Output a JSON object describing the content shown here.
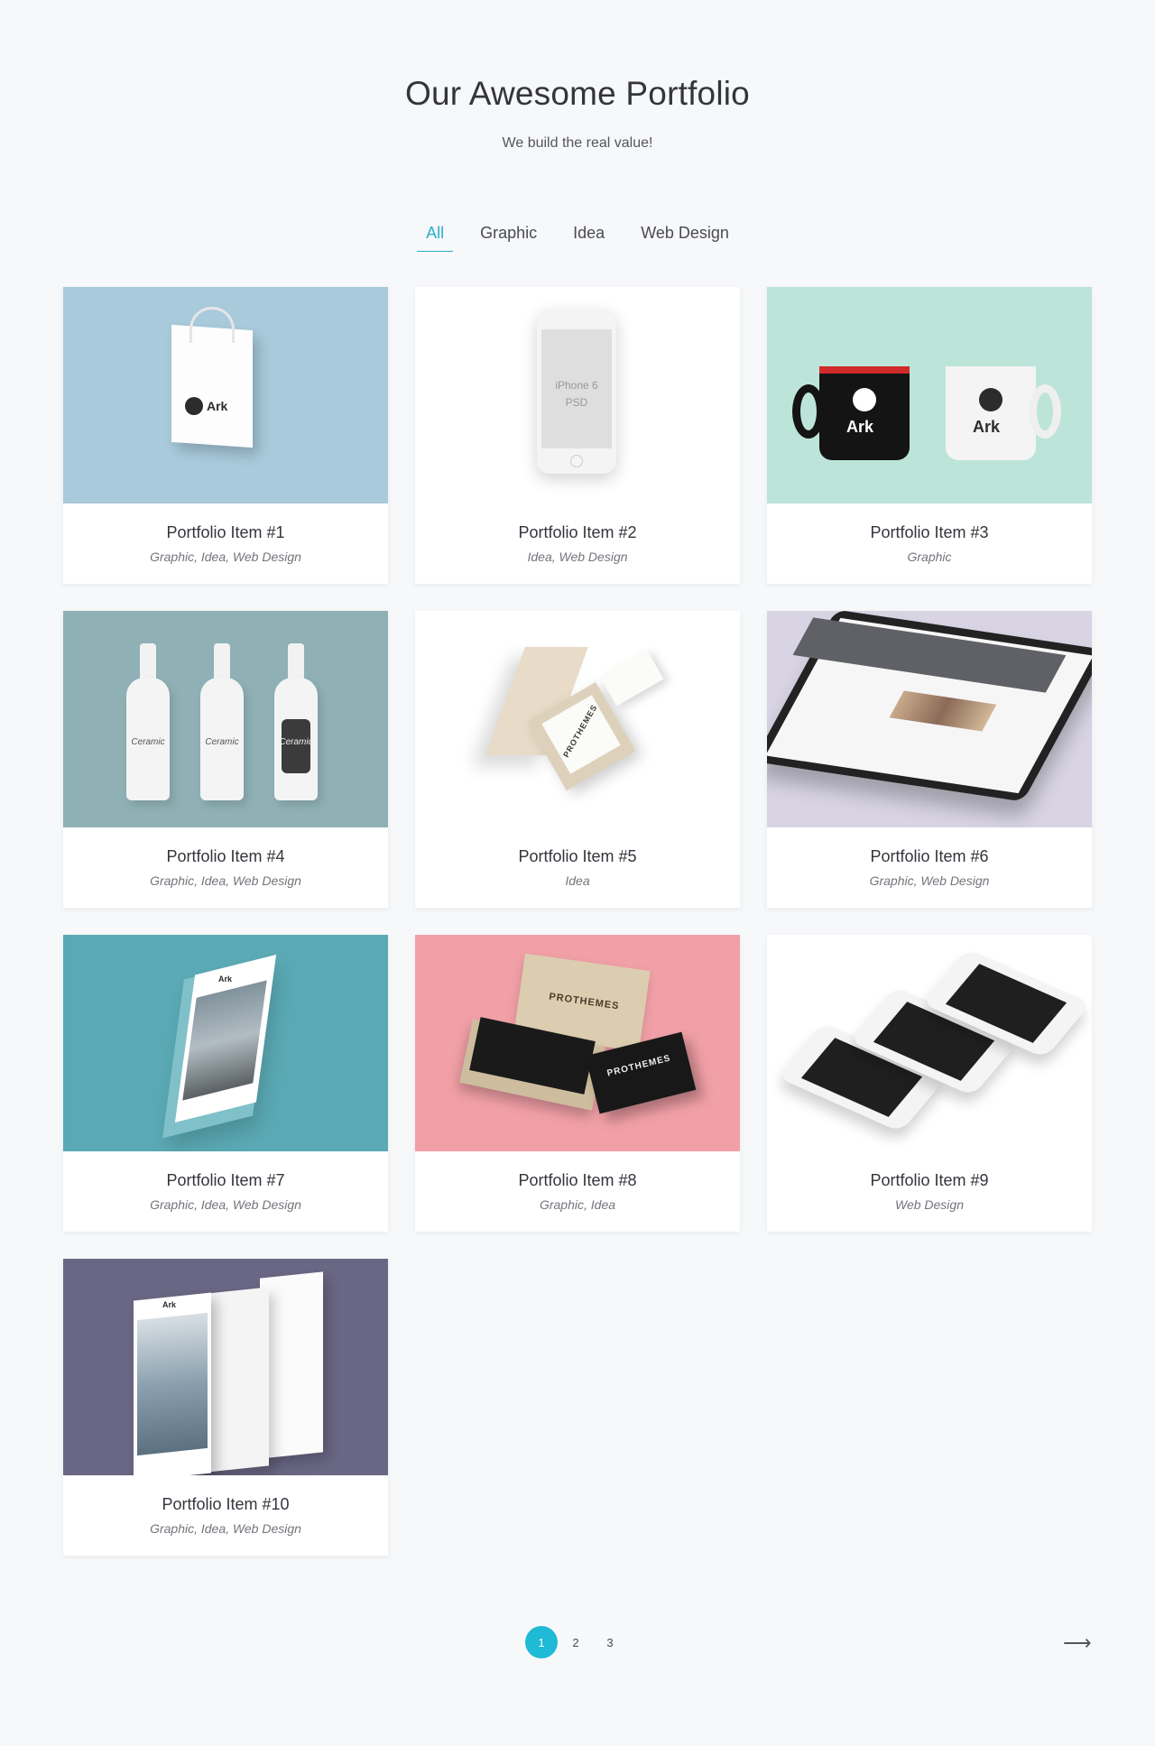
{
  "header": {
    "title": "Our Awesome Portfolio",
    "subtitle": "We build the real value!"
  },
  "filters": [
    {
      "label": "All",
      "active": true
    },
    {
      "label": "Graphic",
      "active": false
    },
    {
      "label": "Idea",
      "active": false
    },
    {
      "label": "Web Design",
      "active": false
    }
  ],
  "items": [
    {
      "title": "Portfolio Item #1",
      "tags": "Graphic, Idea, Web Design",
      "bg": "#a8cadb",
      "art": "bag",
      "brand": "Ark"
    },
    {
      "title": "Portfolio Item #2",
      "tags": "Idea, Web Design",
      "bg": "#ffffff",
      "art": "iphone",
      "screen_text": "iPhone 6\nPSD"
    },
    {
      "title": "Portfolio Item #3",
      "tags": "Graphic",
      "bg": "#bde4d9",
      "art": "mugs",
      "brand": "Ark"
    },
    {
      "title": "Portfolio Item #4",
      "tags": "Graphic, Idea, Web Design",
      "bg": "#8fb1b5",
      "art": "bottles",
      "brand": "Ceramic"
    },
    {
      "title": "Portfolio Item #5",
      "tags": "Idea",
      "bg": "#ffffff",
      "art": "cards-box",
      "brand": "PROTHEMES"
    },
    {
      "title": "Portfolio Item #6",
      "tags": "Graphic, Web Design",
      "bg": "#d8d4e4",
      "art": "tablet"
    },
    {
      "title": "Portfolio Item #7",
      "tags": "Graphic, Idea, Web Design",
      "bg": "#5aa9b4",
      "art": "glass-phone",
      "brand": "Ark"
    },
    {
      "title": "Portfolio Item #8",
      "tags": "Graphic, Idea",
      "bg": "#f2a0a7",
      "art": "black-cards",
      "brand": "PROTHEMES"
    },
    {
      "title": "Portfolio Item #9",
      "tags": "Web Design",
      "bg": "#ffffff",
      "art": "phones"
    },
    {
      "title": "Portfolio Item #10",
      "tags": "Graphic, Idea, Web Design",
      "bg": "#6a6784",
      "art": "screens",
      "brand": "Ark"
    }
  ],
  "pagination": {
    "pages": [
      "1",
      "2",
      "3"
    ],
    "current": "1",
    "next_icon": "arrow-right-icon",
    "next_glyph": "⟶"
  },
  "colors": {
    "accent": "#1fbad6",
    "background": "#f7f8fa"
  }
}
